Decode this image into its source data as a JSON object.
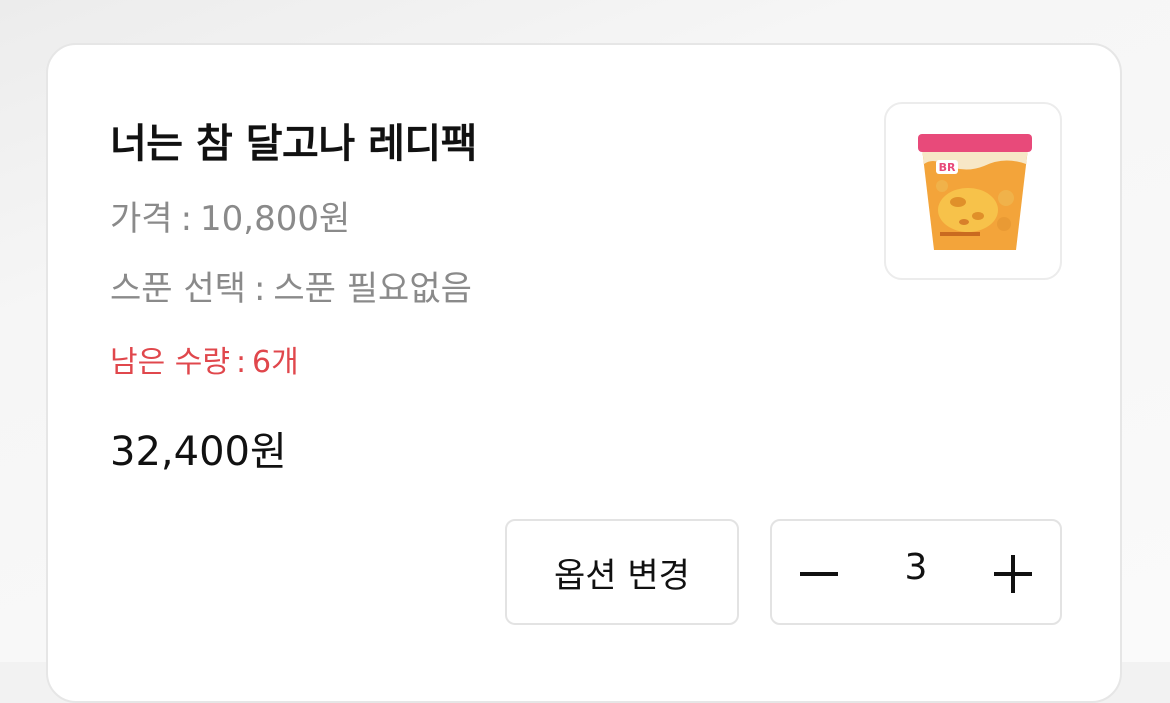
{
  "item": {
    "title": "너는 참 달고나 레디팩",
    "price_label": "가격",
    "price_separator": ":",
    "price_value": "10,800원",
    "option_label": "스푼 선택",
    "option_separator": ":",
    "option_value": "스푼 필요없음",
    "stock_label": "남은 수량",
    "stock_separator": ":",
    "stock_value": "6개",
    "total_price": "32,400원",
    "image_icon": "ice-cream-pint-icon",
    "brand_logo_text": "BR"
  },
  "actions": {
    "change_option_label": "옵션 변경",
    "quantity": "3",
    "minus_icon": "minus-icon",
    "plus_icon": "plus-icon"
  },
  "colors": {
    "stock_text": "#e0474c",
    "title_text": "#111111",
    "muted_text": "#8a8a8a",
    "border": "#e6e6e6"
  }
}
